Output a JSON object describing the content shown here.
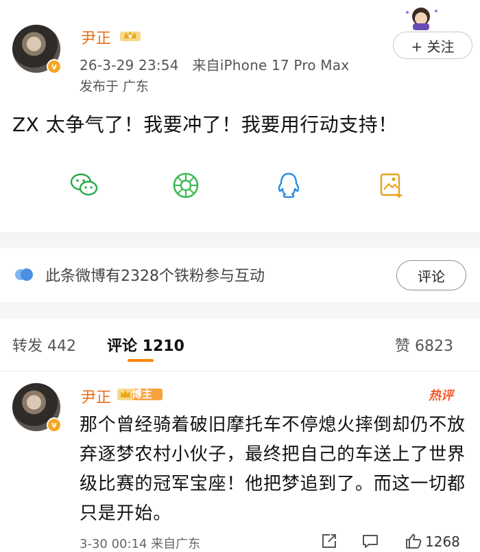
{
  "post": {
    "author": "尹正",
    "timestamp": "26-3-29 23:54",
    "source": "来自iPhone 17 Pro Max",
    "location": "发布于 广东",
    "follow_label": "+ 关注",
    "text": "ZX 太争气了！我要冲了！我要用行动支持！",
    "verified_mark": "v"
  },
  "share": [
    {
      "icon": "wechat-icon",
      "color": "#27a845"
    },
    {
      "icon": "moments-icon",
      "color": "#3dbb52"
    },
    {
      "icon": "qq-icon",
      "color": "#2a8de0"
    },
    {
      "icon": "save-image-icon",
      "color": "#e8a11f"
    }
  ],
  "fans": {
    "text": "此条微博有2328个铁粉参与互动",
    "comment_btn": "评论"
  },
  "tabs": {
    "repost": "转发 442",
    "comments": "评论 1210",
    "likes": "赞 6823"
  },
  "comment": {
    "author": "尹正",
    "badge": "博主",
    "hot_tag": "热评",
    "text": "那个曾经骑着破旧摩托车不停熄火摔倒却仍不放弃逐梦农村小伙子，最终把自己的车送上了世界级比赛的冠军宝座！他把梦追到了。而这一切都只是开始。",
    "time": "3-30 00:14 来自广东",
    "likes": "1268"
  },
  "colors": {
    "accent": "#ff8200",
    "name": "#e8701a",
    "fans_icon": "#4a90e2"
  }
}
